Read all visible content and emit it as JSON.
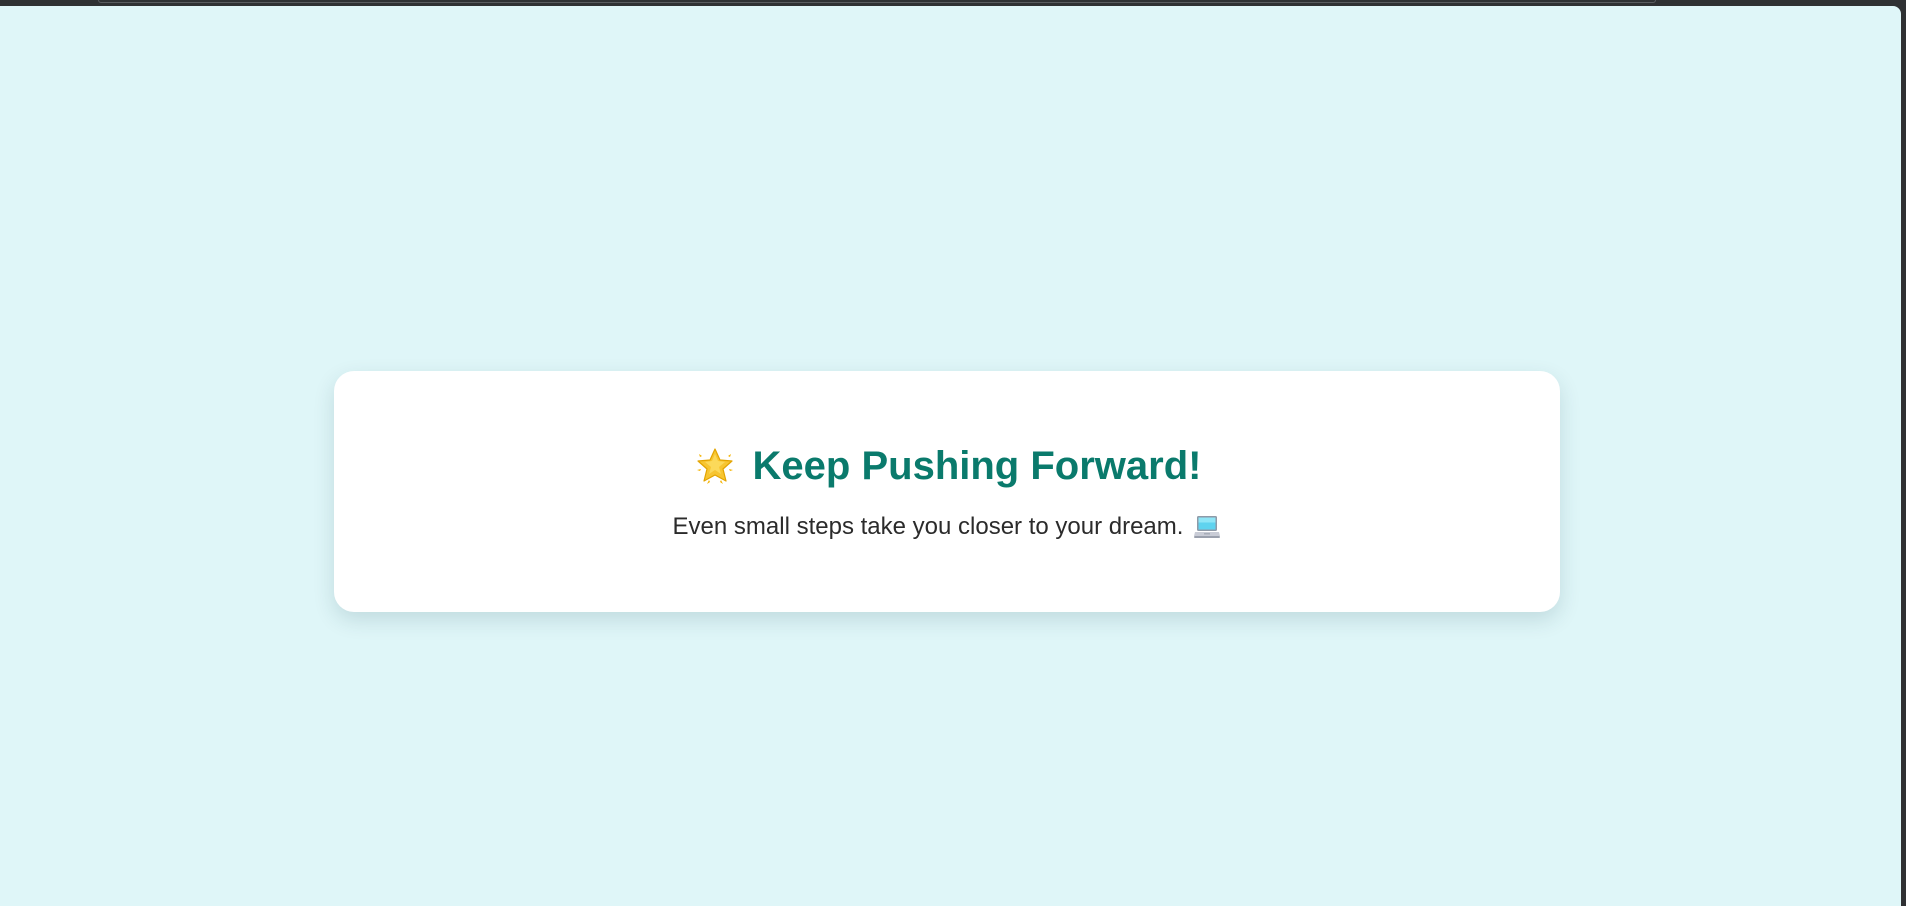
{
  "card": {
    "headline": "Keep Pushing Forward!",
    "subtext": "Even small steps take you closer to your dream.",
    "headline_icon": "glowing-star-icon",
    "subtext_icon": "laptop-icon"
  },
  "colors": {
    "page_background": "#dff6f8",
    "card_background": "#ffffff",
    "headline": "#0a7a6c",
    "body_text": "#2b2b2b",
    "browser_frame": "#2f3133"
  }
}
